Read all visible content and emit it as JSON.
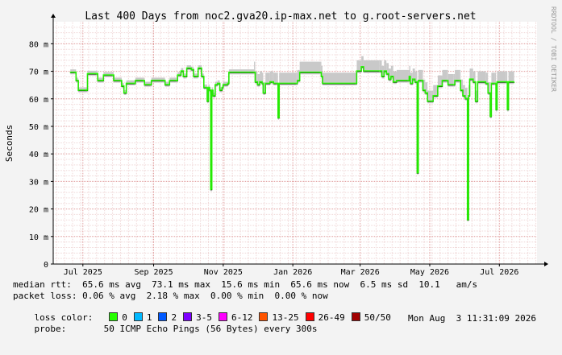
{
  "chart_data": {
    "type": "line",
    "title": "Last 400 Days from noc2.gva20.ip-max.net to g.root-servers.net",
    "ylabel": "Seconds",
    "side_text": "RRDTOOL / TOBI OETIKER",
    "x_range": [
      "2025-06-05",
      "2026-08-03"
    ],
    "ylim": [
      0,
      0.088
    ],
    "yticks": [
      {
        "value": 0,
        "label": "0"
      },
      {
        "value": 0.01,
        "label": "10 m"
      },
      {
        "value": 0.02,
        "label": "20 m"
      },
      {
        "value": 0.03,
        "label": "30 m"
      },
      {
        "value": 0.04,
        "label": "40 m"
      },
      {
        "value": 0.05,
        "label": "50 m"
      },
      {
        "value": 0.06,
        "label": "60 m"
      },
      {
        "value": 0.07,
        "label": "70 m"
      },
      {
        "value": 0.08,
        "label": "80 m"
      }
    ],
    "xticks": [
      {
        "date": "2025-07-01",
        "label": "Jul 2025"
      },
      {
        "date": "2025-09-01",
        "label": "Sep 2025"
      },
      {
        "date": "2025-11-01",
        "label": "Nov 2025"
      },
      {
        "date": "2026-01-01",
        "label": "Jan 2026"
      },
      {
        "date": "2026-03-01",
        "label": "Mar 2026"
      },
      {
        "date": "2026-05-01",
        "label": "May 2026"
      },
      {
        "date": "2026-07-01",
        "label": "Jul 2026"
      }
    ],
    "grid": true,
    "series": [
      {
        "name": "median rtt",
        "values": [
          [
            "2025-06-20",
            0.0695
          ],
          [
            "2025-06-24",
            0.0695
          ],
          [
            "2025-06-25",
            0.0665
          ],
          [
            "2025-06-27",
            0.063
          ],
          [
            "2025-07-04",
            0.063
          ],
          [
            "2025-07-05",
            0.069
          ],
          [
            "2025-07-13",
            0.069
          ],
          [
            "2025-07-14",
            0.0665
          ],
          [
            "2025-07-18",
            0.0665
          ],
          [
            "2025-07-19",
            0.0685
          ],
          [
            "2025-07-27",
            0.0685
          ],
          [
            "2025-07-28",
            0.0665
          ],
          [
            "2025-08-03",
            0.0665
          ],
          [
            "2025-08-04",
            0.0645
          ],
          [
            "2025-08-06",
            0.062
          ],
          [
            "2025-08-08",
            0.0655
          ],
          [
            "2025-08-15",
            0.0655
          ],
          [
            "2025-08-16",
            0.0665
          ],
          [
            "2025-08-23",
            0.0665
          ],
          [
            "2025-08-24",
            0.065
          ],
          [
            "2025-08-29",
            0.065
          ],
          [
            "2025-08-30",
            0.0665
          ],
          [
            "2025-09-10",
            0.0665
          ],
          [
            "2025-09-11",
            0.065
          ],
          [
            "2025-09-14",
            0.065
          ],
          [
            "2025-09-15",
            0.0665
          ],
          [
            "2025-09-21",
            0.0665
          ],
          [
            "2025-09-22",
            0.0685
          ],
          [
            "2025-09-25",
            0.07
          ],
          [
            "2025-09-27",
            0.068
          ],
          [
            "2025-09-29",
            0.068
          ],
          [
            "2025-09-30",
            0.071
          ],
          [
            "2025-10-04",
            0.0705
          ],
          [
            "2025-10-06",
            0.068
          ],
          [
            "2025-10-09",
            0.068
          ],
          [
            "2025-10-10",
            0.071
          ],
          [
            "2025-10-13",
            0.068
          ],
          [
            "2025-10-15",
            0.064
          ],
          [
            "2025-10-17",
            0.064
          ],
          [
            "2025-10-18",
            0.059
          ],
          [
            "2025-10-19",
            0.064
          ],
          [
            "2025-10-20",
            0.063
          ],
          [
            "2025-10-21",
            0.027
          ],
          [
            "2025-10-22",
            0.063
          ],
          [
            "2025-10-23",
            0.061
          ],
          [
            "2025-10-25",
            0.065
          ],
          [
            "2025-10-27",
            0.0655
          ],
          [
            "2025-10-29",
            0.063
          ],
          [
            "2025-10-31",
            0.064
          ],
          [
            "2025-11-01",
            0.065
          ],
          [
            "2025-11-05",
            0.0655
          ],
          [
            "2025-11-06",
            0.0695
          ],
          [
            "2025-11-28",
            0.0695
          ],
          [
            "2025-11-29",
            0.066
          ],
          [
            "2025-12-01",
            0.065
          ],
          [
            "2025-12-03",
            0.066
          ],
          [
            "2025-12-05",
            0.0655
          ],
          [
            "2025-12-06",
            0.062
          ],
          [
            "2025-12-08",
            0.0655
          ],
          [
            "2025-12-12",
            0.066
          ],
          [
            "2025-12-14",
            0.066
          ],
          [
            "2025-12-15",
            0.0655
          ],
          [
            "2025-12-18",
            0.0655
          ],
          [
            "2025-12-19",
            0.053
          ],
          [
            "2025-12-20",
            0.0655
          ],
          [
            "2026-01-04",
            0.0655
          ],
          [
            "2026-01-05",
            0.0665
          ],
          [
            "2026-01-07",
            0.0695
          ],
          [
            "2026-01-25",
            0.0695
          ],
          [
            "2026-01-26",
            0.068
          ],
          [
            "2026-01-27",
            0.0655
          ],
          [
            "2026-02-25",
            0.0655
          ],
          [
            "2026-02-26",
            0.07
          ],
          [
            "2026-03-02",
            0.0715
          ],
          [
            "2026-03-04",
            0.07
          ],
          [
            "2026-03-18",
            0.07
          ],
          [
            "2026-03-20",
            0.068
          ],
          [
            "2026-03-22",
            0.07
          ],
          [
            "2026-03-24",
            0.069
          ],
          [
            "2026-03-26",
            0.067
          ],
          [
            "2026-03-28",
            0.068
          ],
          [
            "2026-03-30",
            0.066
          ],
          [
            "2026-04-02",
            0.0665
          ],
          [
            "2026-04-12",
            0.0665
          ],
          [
            "2026-04-13",
            0.068
          ],
          [
            "2026-04-14",
            0.0655
          ],
          [
            "2026-04-16",
            0.067
          ],
          [
            "2026-04-18",
            0.066
          ],
          [
            "2026-04-20",
            0.033
          ],
          [
            "2026-04-21",
            0.0665
          ],
          [
            "2026-04-24",
            0.0665
          ],
          [
            "2026-04-25",
            0.063
          ],
          [
            "2026-04-27",
            0.062
          ],
          [
            "2026-04-29",
            0.059
          ],
          [
            "2026-05-03",
            0.059
          ],
          [
            "2026-05-04",
            0.061
          ],
          [
            "2026-05-08",
            0.0645
          ],
          [
            "2026-05-12",
            0.0665
          ],
          [
            "2026-05-16",
            0.0665
          ],
          [
            "2026-05-17",
            0.065
          ],
          [
            "2026-05-22",
            0.065
          ],
          [
            "2026-05-23",
            0.0665
          ],
          [
            "2026-05-27",
            0.0665
          ],
          [
            "2026-05-28",
            0.063
          ],
          [
            "2026-05-30",
            0.061
          ],
          [
            "2026-06-01",
            0.06
          ],
          [
            "2026-06-03",
            0.016
          ],
          [
            "2026-06-04",
            0.061
          ],
          [
            "2026-06-05",
            0.067
          ],
          [
            "2026-06-08",
            0.066
          ],
          [
            "2026-06-10",
            0.059
          ],
          [
            "2026-06-12",
            0.066
          ],
          [
            "2026-06-19",
            0.0655
          ],
          [
            "2026-06-21",
            0.062
          ],
          [
            "2026-06-23",
            0.0535
          ],
          [
            "2026-06-24",
            0.0655
          ],
          [
            "2026-06-27",
            0.0655
          ],
          [
            "2026-06-28",
            0.056
          ],
          [
            "2026-06-29",
            0.066
          ],
          [
            "2026-07-07",
            0.066
          ],
          [
            "2026-07-08",
            0.056
          ],
          [
            "2026-07-09",
            0.066
          ],
          [
            "2026-07-14",
            0.066
          ]
        ]
      }
    ]
  },
  "stats": {
    "rtt": "median rtt:  65.6 ms avg  73.1 ms max  15.6 ms min  65.6 ms now  6.5 ms sd  10.1   am/s",
    "loss": "packet loss: 0.06 % avg  2.18 % max  0.00 % min  0.00 % now",
    "loss_color_label": "loss color:",
    "probe": "probe:       50 ICMP Echo Pings (56 Bytes) every 300s",
    "date": "Mon Aug  3 11:31:09 2026"
  },
  "loss_legend": [
    {
      "label": "0",
      "color": "#26ff00"
    },
    {
      "label": "1",
      "color": "#00b8ff"
    },
    {
      "label": "2",
      "color": "#0059ff"
    },
    {
      "label": "3-5",
      "color": "#7e00ff"
    },
    {
      "label": "6-12",
      "color": "#ff00ff"
    },
    {
      "label": "13-25",
      "color": "#ff5500"
    },
    {
      "label": "26-49",
      "color": "#ff0000"
    },
    {
      "label": "50/50",
      "color": "#a10000"
    }
  ],
  "colors": {
    "canvas": "#ffffff",
    "background": "#f3f3f3",
    "grid_major": "#e2a0a0",
    "grid_minor": "#f0d8d8",
    "smoke": "#c9c9c9",
    "median": "#26ff00",
    "spike": "#000000"
  }
}
